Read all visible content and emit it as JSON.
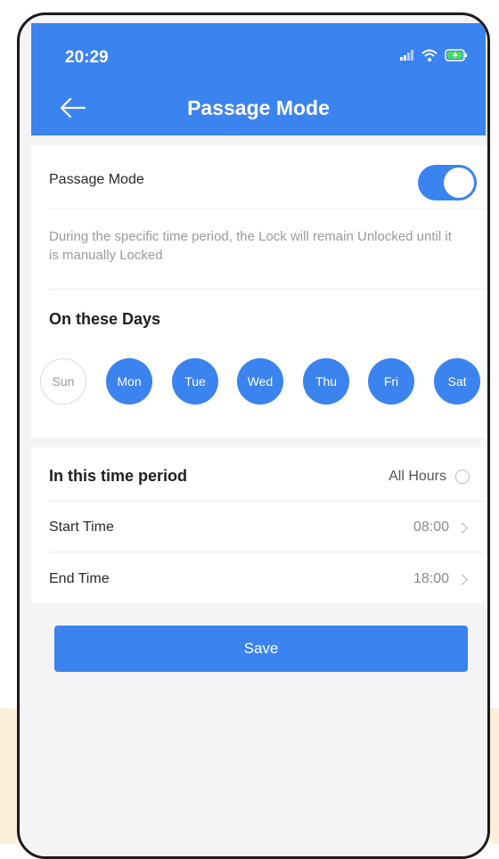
{
  "status_bar": {
    "time": "20:29"
  },
  "header": {
    "title": "Passage Mode"
  },
  "passage": {
    "label": "Passage Mode",
    "enabled": true,
    "description": "During the specific time period, the Lock will remain Unlocked until it is manually Locked"
  },
  "days": {
    "title": "On these Days",
    "items": [
      {
        "label": "Sun",
        "selected": false
      },
      {
        "label": "Mon",
        "selected": true
      },
      {
        "label": "Tue",
        "selected": true
      },
      {
        "label": "Wed",
        "selected": true
      },
      {
        "label": "Thu",
        "selected": true
      },
      {
        "label": "Fri",
        "selected": true
      },
      {
        "label": "Sat",
        "selected": true
      }
    ]
  },
  "period": {
    "title": "In this time period",
    "all_hours_label": "All Hours",
    "all_hours_checked": false,
    "start_label": "Start Time",
    "start_value": "08:00",
    "end_label": "End Time",
    "end_value": "18:00"
  },
  "actions": {
    "save_label": "Save"
  },
  "colors": {
    "accent": "#3b83ee",
    "background": "#f4f4f6"
  }
}
